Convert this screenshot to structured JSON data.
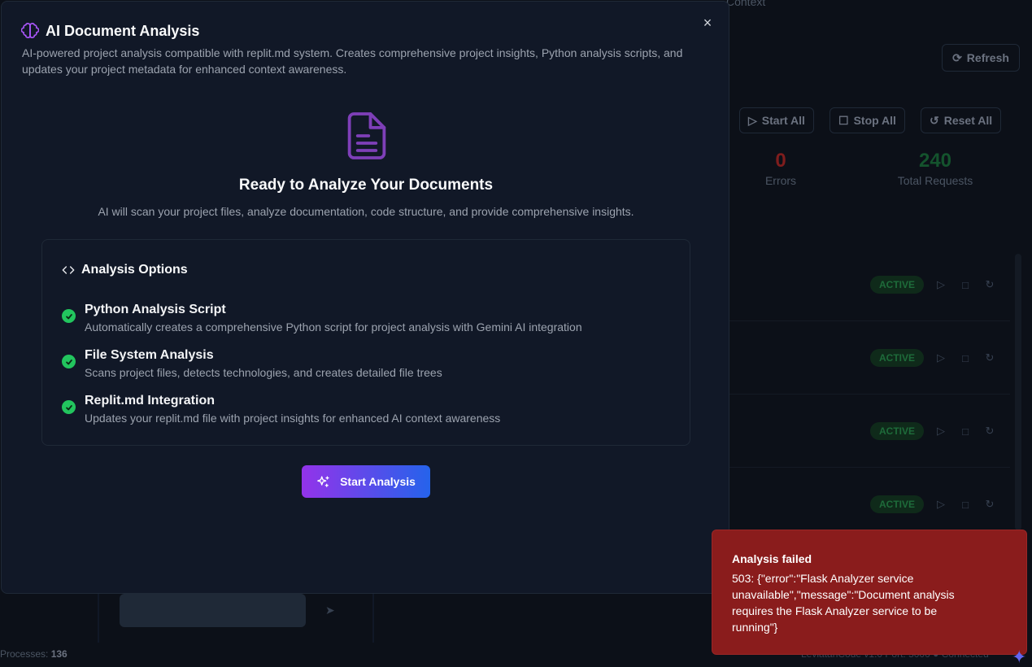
{
  "background": {
    "top_context": "Context",
    "refresh_label": "Refresh",
    "controls": [
      "Start All",
      "Stop All",
      "Reset All"
    ],
    "stats": [
      {
        "value": "0",
        "label": "Errors",
        "color": "#7f1d1d"
      },
      {
        "value": "240",
        "label": "Total Requests",
        "color": "#14532d"
      }
    ],
    "row_badge": "ACTIVE",
    "status_left_label": "Processes:",
    "status_left_value": "136",
    "status_right": "LeviatanCode v1.0   Port: 5000   ● Connected"
  },
  "modal": {
    "title": "AI Document Analysis",
    "subtitle": "AI-powered project analysis compatible with replit.md system. Creates comprehensive project insights, Python analysis scripts, and updates your project metadata for enhanced context awareness.",
    "hero_title": "Ready to Analyze Your Documents",
    "hero_desc": "AI will scan your project files, analyze documentation, code structure, and provide comprehensive insights.",
    "options_title": "Analysis Options",
    "options": [
      {
        "title": "Python Analysis Script",
        "desc": "Automatically creates a comprehensive Python script for project analysis with Gemini AI integration"
      },
      {
        "title": "File System Analysis",
        "desc": "Scans project files, detects technologies, and creates detailed file trees"
      },
      {
        "title": "Replit.md Integration",
        "desc": "Updates your replit.md file with project insights for enhanced AI context awareness"
      }
    ],
    "start_button": "Start Analysis",
    "close_symbol": "×"
  },
  "toast": {
    "title": "Analysis failed",
    "message": "503: {\"error\":\"Flask Analyzer service unavailable\",\"message\":\"Document analysis requires the Flask Analyzer service to be running\"}"
  },
  "colors": {
    "accent_purple": "#9333ea",
    "accent_blue": "#2563eb",
    "success": "#22c55e",
    "error_bg": "#8a1c1c"
  }
}
